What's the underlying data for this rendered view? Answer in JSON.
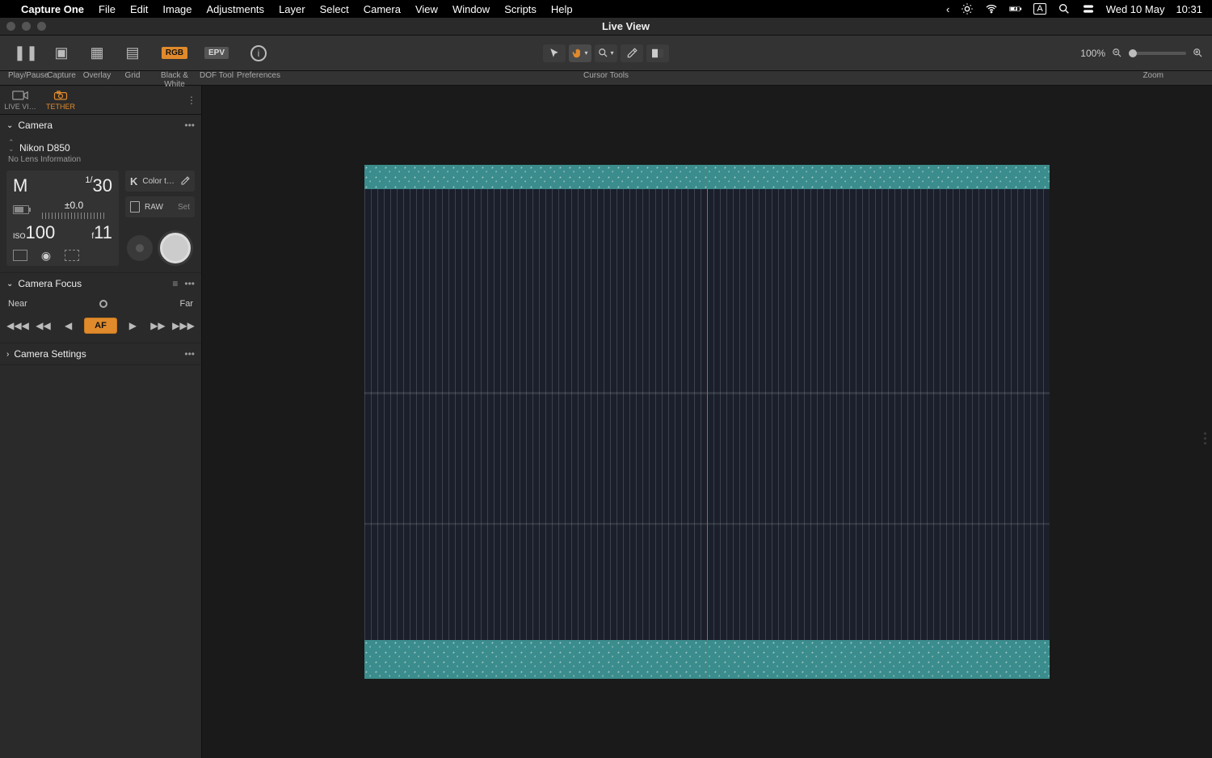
{
  "menubar": {
    "app": "Capture One",
    "items": [
      "File",
      "Edit",
      "Image",
      "Adjustments",
      "Layer",
      "Select",
      "Camera",
      "View",
      "Window",
      "Scripts",
      "Help"
    ],
    "status_date": "Wed 10 May",
    "status_time": "10:31",
    "status_input": "A"
  },
  "window": {
    "title": "Live View"
  },
  "toolbar": {
    "play_pause": "Play/Pause",
    "capture": "Capture",
    "overlay": "Overlay",
    "grid": "Grid",
    "bw": "Black & White",
    "dof": "DOF Tool",
    "prefs": "Preferences",
    "rgb_badge": "RGB",
    "epv_badge": "EPV",
    "info_glyph": "i",
    "cursor_label": "Cursor Tools",
    "zoom_value": "100%",
    "zoom_label": "Zoom"
  },
  "sidebar": {
    "tab_live": "LIVE VI…",
    "tab_tether": "TETHER",
    "camera_panel": {
      "title": "Camera",
      "model": "Nikon D850",
      "lens": "No Lens Information",
      "mode": "M",
      "shutter_numerator": "1/",
      "shutter_denominator": "30",
      "ev": "±0.0",
      "iso_prefix": "ISO",
      "iso": "100",
      "f_prefix": "f",
      "f": "11",
      "kelvin": "K",
      "color_temp_label": "Color t…",
      "raw": "RAW",
      "set": "Set"
    },
    "focus_panel": {
      "title": "Camera Focus",
      "near": "Near",
      "far": "Far",
      "af": "AF"
    },
    "settings_panel": {
      "title": "Camera Settings"
    }
  }
}
